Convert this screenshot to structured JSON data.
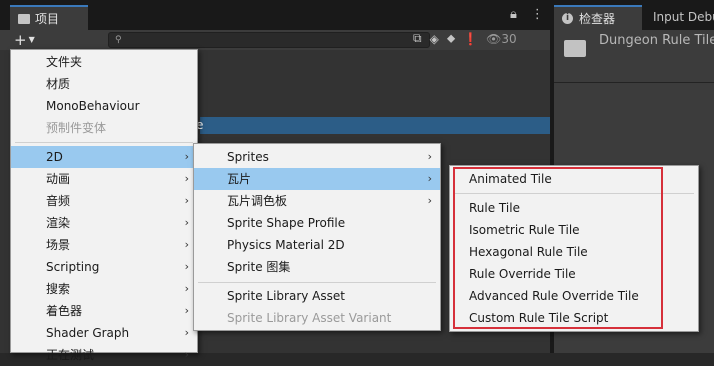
{
  "project_panel": {
    "tab_label": "项目",
    "search": {
      "value": "",
      "placeholder": ""
    },
    "visible_count": "30",
    "selected_item_text": "e"
  },
  "inspector": {
    "tab_label": "检查器",
    "other_tab_label": "Input Debu",
    "asset_title": "Dungeon Rule Tile"
  },
  "create_menu": {
    "items": [
      {
        "label": "文件夹",
        "submenu": false,
        "disabled": false
      },
      {
        "label": "材质",
        "submenu": false,
        "disabled": false
      },
      {
        "label": "MonoBehaviour",
        "submenu": false,
        "disabled": false
      },
      {
        "label": "预制件变体",
        "submenu": false,
        "disabled": true
      },
      {
        "label": "2D",
        "submenu": true,
        "disabled": false,
        "highlighted": true
      },
      {
        "label": "动画",
        "submenu": true
      },
      {
        "label": "音频",
        "submenu": true
      },
      {
        "label": "渲染",
        "submenu": true
      },
      {
        "label": "场景",
        "submenu": true
      },
      {
        "label": "Scripting",
        "submenu": true
      },
      {
        "label": "搜索",
        "submenu": true
      },
      {
        "label": "着色器",
        "submenu": true
      },
      {
        "label": "Shader Graph",
        "submenu": true
      },
      {
        "label": "正在测试",
        "submenu": true
      }
    ]
  },
  "submenu_2d": {
    "items": [
      {
        "label": "Sprites",
        "submenu": true
      },
      {
        "label": "瓦片",
        "submenu": true,
        "highlighted": true
      },
      {
        "label": "瓦片调色板",
        "submenu": true
      },
      {
        "label": "Sprite Shape Profile"
      },
      {
        "label": "Physics Material 2D"
      },
      {
        "label": "Sprite 图集"
      },
      {
        "label": "Sprite Library Asset"
      },
      {
        "label": "Sprite Library Asset Variant",
        "disabled": true
      }
    ]
  },
  "submenu_tile": {
    "items": [
      {
        "label": "Animated Tile"
      },
      {
        "label": "Rule Tile"
      },
      {
        "label": "Isometric Rule Tile"
      },
      {
        "label": "Hexagonal Rule Tile"
      },
      {
        "label": "Rule Override Tile"
      },
      {
        "label": "Advanced Rule Override Tile"
      },
      {
        "label": "Custom Rule Tile Script"
      }
    ]
  },
  "colors": {
    "highlight": "#99c9ef",
    "callout_border": "#d6303a",
    "selection": "#2c5d87"
  }
}
